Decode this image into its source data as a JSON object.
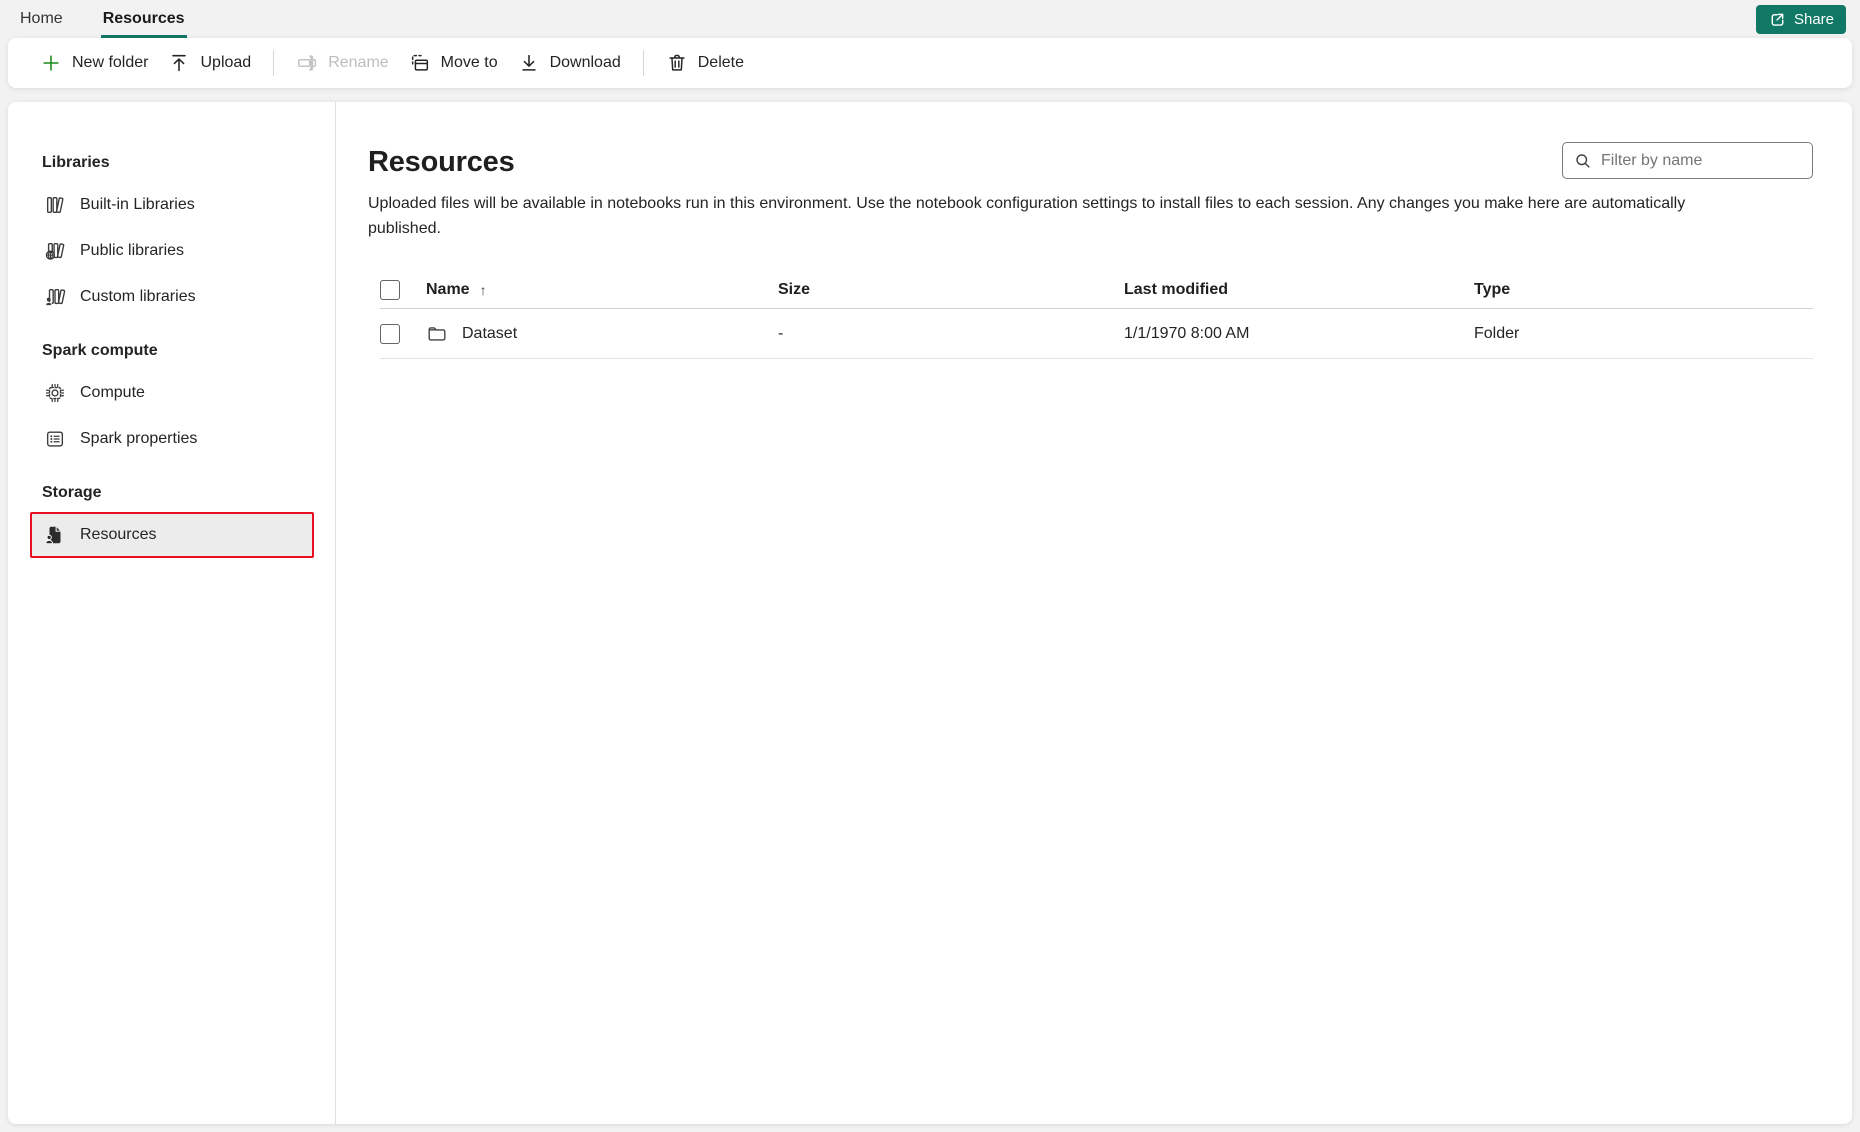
{
  "colors": {
    "accent": "#117865",
    "selection_border": "#e81123",
    "add_green": "#1a8a1a"
  },
  "tabs": [
    {
      "label": "Home",
      "active": false
    },
    {
      "label": "Resources",
      "active": true
    }
  ],
  "share": {
    "label": "Share"
  },
  "toolbar": {
    "items": [
      {
        "label": "New folder",
        "icon": "new-folder-plus-icon",
        "disabled": false
      },
      {
        "label": "Upload",
        "icon": "upload-icon",
        "disabled": false
      },
      {
        "label": "Rename",
        "icon": "rename-icon",
        "disabled": true
      },
      {
        "label": "Move to",
        "icon": "move-to-icon",
        "disabled": false
      },
      {
        "label": "Download",
        "icon": "download-icon",
        "disabled": false
      },
      {
        "label": "Delete",
        "icon": "delete-icon",
        "disabled": false
      }
    ]
  },
  "sidebar": {
    "sections": [
      {
        "heading": "Libraries",
        "items": [
          {
            "label": "Built-in Libraries",
            "icon": "built-in-libraries-icon",
            "selected": false
          },
          {
            "label": "Public libraries",
            "icon": "public-libraries-icon",
            "selected": false
          },
          {
            "label": "Custom libraries",
            "icon": "custom-libraries-icon",
            "selected": false
          }
        ]
      },
      {
        "heading": "Spark compute",
        "items": [
          {
            "label": "Compute",
            "icon": "compute-icon",
            "selected": false
          },
          {
            "label": "Spark properties",
            "icon": "spark-properties-icon",
            "selected": false
          }
        ]
      },
      {
        "heading": "Storage",
        "items": [
          {
            "label": "Resources",
            "icon": "resources-icon",
            "selected": true
          }
        ]
      }
    ]
  },
  "main": {
    "title": "Resources",
    "description": "Uploaded files will be available in notebooks run in this environment. Use the notebook configuration settings to install files to each session. Any changes you make here are automatically published.",
    "filter": {
      "placeholder": "Filter by name",
      "value": ""
    },
    "table": {
      "columns": [
        "Name",
        "Size",
        "Last modified",
        "Type"
      ],
      "sort": {
        "column": "Name",
        "direction": "ascending",
        "glyph": "↑"
      },
      "rows": [
        {
          "name": "Dataset",
          "icon": "folder-icon",
          "size": "-",
          "last_modified": "1/1/1970 8:00 AM",
          "type": "Folder",
          "checked": false
        }
      ]
    }
  }
}
